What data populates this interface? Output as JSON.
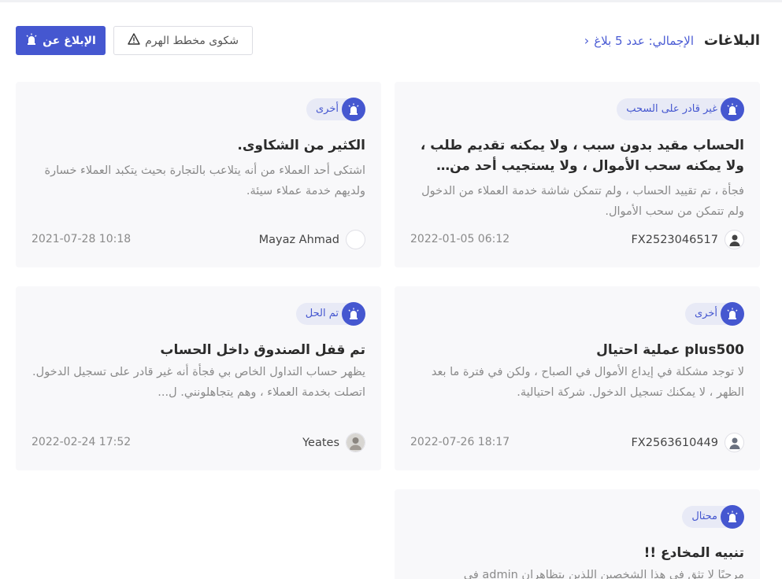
{
  "header": {
    "title": "البلاغات",
    "total_label": "الإجمالي: عدد 5 بلاغ",
    "report_button": "الإبلاغ عن",
    "pyramid_button": "شكوى مخطط الهرم"
  },
  "cards": [
    {
      "tag": "غير قادر على السحب",
      "title": "الحساب مقيد بدون سبب ، ولا يمكنه تقديم طلب ، ولا يمكنه سحب الأموال ، ولا يستجيب أحد من خدم...",
      "desc": "فجأة ، تم تقييد الحساب ، ولم تتمكن شاشة خدمة العملاء من الدخول ولم تتمكن من سحب الأموال.",
      "user": "FX2523046517",
      "date": "2022-01-05 06:12"
    },
    {
      "tag": "أخرى",
      "title": "الكثير من الشكاوى.",
      "desc": "اشتكى أحد العملاء من أنه يتلاعب بالتجارة بحيث يتكبد العملاء خسارة ولديهم خدمة عملاء سيئة.",
      "user": "Mayaz Ahmad",
      "date": "2021-07-28 10:18"
    },
    {
      "tag": "أخرى",
      "title": "plus500 عملية احتيال",
      "desc": "لا توجد مشكلة في إيداع الأموال في الصباح ، ولكن في فترة ما بعد الظهر ، لا يمكنك تسجيل الدخول. شركة احتيالية.",
      "user": "FX2563610449",
      "date": "2022-07-26 18:17"
    },
    {
      "tag": "تم الحل",
      "title": "تم قفل الصندوق داخل الحساب",
      "desc": "يظهر حساب التداول الخاص بي فجأة أنه غير قادر على تسجيل الدخول. اتصلت بخدمة العملاء ، وهم يتجاهلونني. ل...",
      "user": "Yeates",
      "date": "2022-02-24 17:52"
    },
    {
      "tag": "محتال",
      "title": "تنبيه المخادع !!",
      "desc": "مرحبًا لا تثق في هذا الشخصين اللذين يتظاهران admin في"
    }
  ],
  "colors": {
    "accent": "#4557d0",
    "tag_bg": "#e8eaf6",
    "card_bg": "#f8f8fa",
    "muted_text": "#8a8a8a"
  }
}
